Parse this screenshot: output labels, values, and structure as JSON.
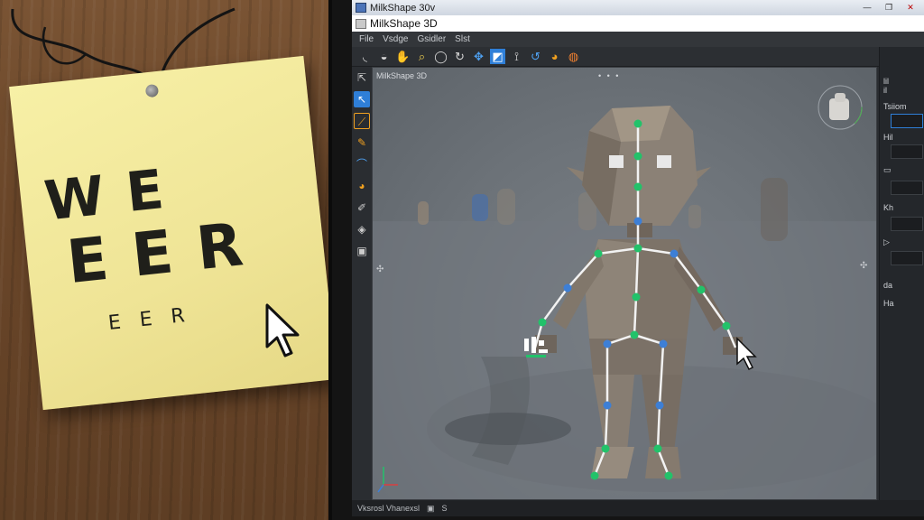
{
  "window": {
    "title": "MilkShape 30v",
    "subtitle": "MilkShape 3D",
    "controls": [
      "—",
      "❐",
      "✕"
    ]
  },
  "menu": [
    "File",
    "Vsdge",
    "Gsidler",
    "Slst"
  ],
  "viewport": {
    "label": "MilkShape 3D",
    "dots": "• • •"
  },
  "sticky_note": {
    "line1": "W E",
    "line2": "E E R",
    "line3": "E   E   R"
  },
  "right_panel": [
    "lil",
    "il",
    "Tsiiom",
    "Hil",
    "Kh",
    "da",
    "Ha"
  ],
  "status": {
    "left": "Vksrosl Vhanexsl",
    "right": "S"
  },
  "colors": {
    "accent": "#2f7fd8",
    "joint_green": "#22c26a",
    "joint_blue": "#3d7fd6",
    "bone": "#f2f2f2",
    "toolbar_orange": "#f0a020"
  },
  "icons": {
    "toolbar": [
      "arc-icon",
      "lasso-icon",
      "hand-icon",
      "magnify-icon",
      "circle-icon",
      "rotate-icon",
      "move-icon",
      "scale-icon",
      "joint-icon",
      "rotate-ccw-icon",
      "bone-icon",
      "skin-icon"
    ],
    "left": [
      "cursor-icon",
      "select-icon",
      "bone-tool-icon",
      "pencil-icon",
      "joint-tool-icon",
      "paint-icon",
      "brush-icon",
      "eye-icon",
      "camera-icon"
    ]
  }
}
